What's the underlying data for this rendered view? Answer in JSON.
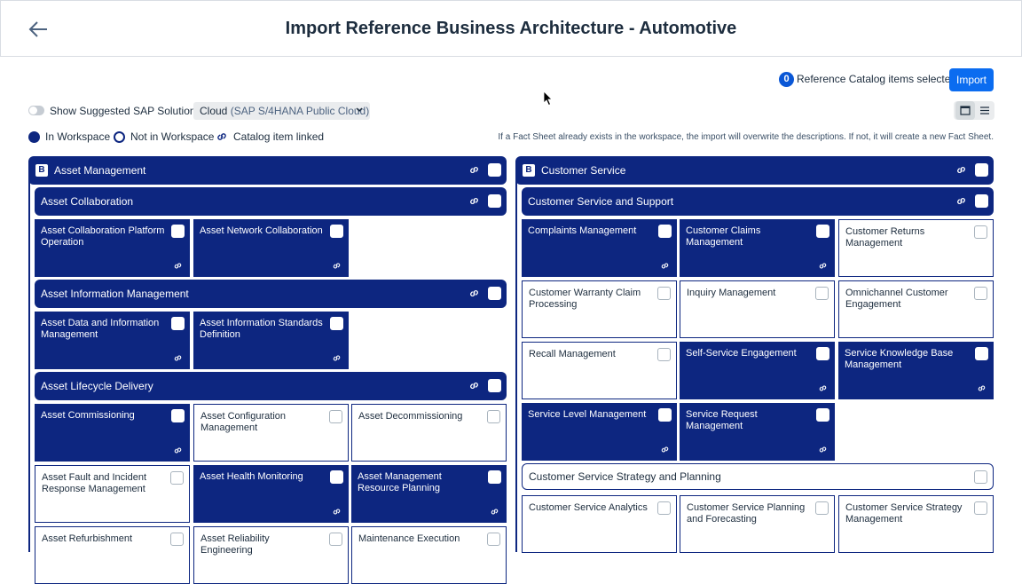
{
  "header": {
    "title": "Import Reference Business Architecture - Automotive"
  },
  "selection": {
    "count": "0",
    "label": "Reference Catalog items selected",
    "import_label": "Import"
  },
  "filters": {
    "toggle_label": "Show Suggested SAP Solutions",
    "dropdown_value": "Cloud",
    "dropdown_sub": "(SAP S/4HANA Public Cloud)"
  },
  "legend": {
    "in_workspace": "In Workspace",
    "not_in_workspace": "Not in Workspace",
    "linked": "Catalog item linked"
  },
  "info": "If a Fact Sheet already exists in the workspace, the import will overwrite the descriptions. If not, it will create a new Fact Sheet.",
  "badge_letter": "B",
  "left": {
    "domain": "Asset Management",
    "groups": [
      {
        "name": "Asset Collaboration",
        "items": [
          "Asset Collaboration Platform Operation",
          "Asset Network Collaboration"
        ]
      },
      {
        "name": "Asset Information Management",
        "items": [
          "Asset Data and Information Management",
          "Asset Information Standards Definition"
        ]
      },
      {
        "name": "Asset Lifecycle Delivery",
        "items": [
          "Asset Commissioning",
          "Asset Configuration Management",
          "Asset Decommissioning",
          "Asset Fault and Incident Response Management",
          "Asset Health Monitoring",
          "Asset Management Resource Planning",
          "Asset Refurbishment",
          "Asset Reliability Engineering",
          "Maintenance Execution"
        ]
      }
    ]
  },
  "right": {
    "domain": "Customer Service",
    "groups": [
      {
        "name": "Customer Service and Support",
        "items": [
          "Complaints Management",
          "Customer Claims Management",
          "Customer Returns Management",
          "Customer Warranty Claim Processing",
          "Inquiry Management",
          "Omnichannel Customer Engagement",
          "Recall Management",
          "Self-Service Engagement",
          "Service Knowledge Base Management",
          "Service Level Management",
          "Service Request Management"
        ]
      },
      {
        "name": "Customer Service Strategy and Planning",
        "items": [
          "Customer Service Analytics",
          "Customer Service Planning and Forecasting",
          "Customer Service Strategy Management"
        ]
      }
    ]
  },
  "colors": {
    "in_workspace": "#0d2680",
    "accent": "#0b6cf0"
  }
}
